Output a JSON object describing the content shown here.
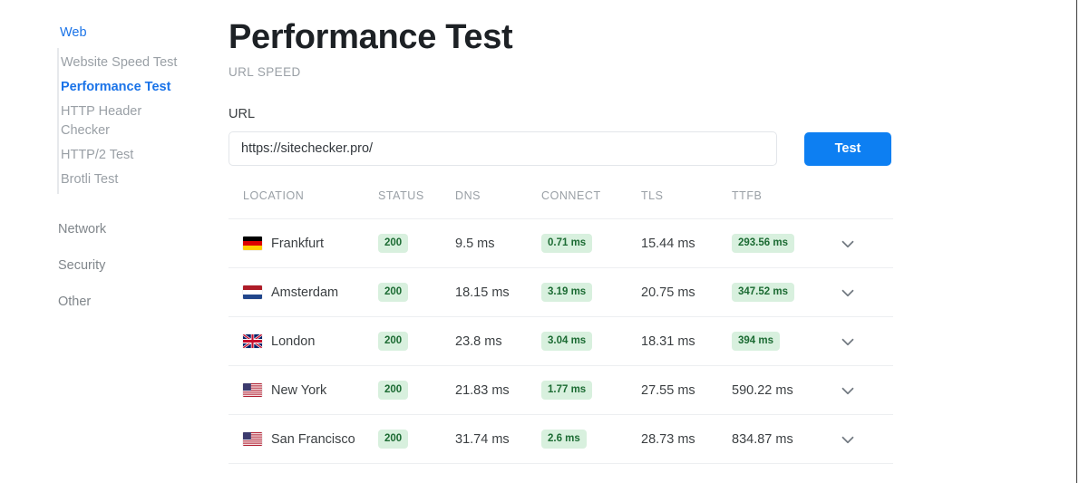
{
  "sidebar": {
    "groups": [
      {
        "label": "Web",
        "active": true,
        "items": [
          {
            "label": "Website Speed Test",
            "active": false
          },
          {
            "label": "Performance Test",
            "active": true
          },
          {
            "label": "HTTP Header Checker",
            "active": false
          },
          {
            "label": "HTTP/2 Test",
            "active": false
          },
          {
            "label": "Brotli Test",
            "active": false
          }
        ]
      }
    ],
    "top_items": [
      {
        "label": "Network"
      },
      {
        "label": "Security"
      },
      {
        "label": "Other"
      }
    ]
  },
  "header": {
    "title": "Performance Test",
    "subtitle": "URL SPEED"
  },
  "form": {
    "url_label": "URL",
    "url_value": "https://sitechecker.pro/",
    "url_placeholder": "https://sitechecker.pro/",
    "test_label": "Test"
  },
  "table": {
    "columns": [
      "LOCATION",
      "STATUS",
      "DNS",
      "CONNECT",
      "TLS",
      "TTFB"
    ],
    "expand_icon": "chevron-down-icon",
    "rows": [
      {
        "flag": "de",
        "location": "Frankfurt",
        "status": "200",
        "status_badge": true,
        "dns": "9.5 ms",
        "dns_badge": false,
        "connect": "0.71 ms",
        "connect_badge": true,
        "tls": "15.44 ms",
        "tls_badge": false,
        "ttfb": "293.56 ms",
        "ttfb_badge": true
      },
      {
        "flag": "nl",
        "location": "Amsterdam",
        "status": "200",
        "status_badge": true,
        "dns": "18.15 ms",
        "dns_badge": false,
        "connect": "3.19 ms",
        "connect_badge": true,
        "tls": "20.75 ms",
        "tls_badge": false,
        "ttfb": "347.52 ms",
        "ttfb_badge": true
      },
      {
        "flag": "gb",
        "location": "London",
        "status": "200",
        "status_badge": true,
        "dns": "23.8 ms",
        "dns_badge": false,
        "connect": "3.04 ms",
        "connect_badge": true,
        "tls": "18.31 ms",
        "tls_badge": false,
        "ttfb": "394 ms",
        "ttfb_badge": true
      },
      {
        "flag": "us",
        "location": "New York",
        "status": "200",
        "status_badge": true,
        "dns": "21.83 ms",
        "dns_badge": false,
        "connect": "1.77 ms",
        "connect_badge": true,
        "tls": "27.55 ms",
        "tls_badge": false,
        "ttfb": "590.22 ms",
        "ttfb_badge": false
      },
      {
        "flag": "us",
        "location": "San Francisco",
        "status": "200",
        "status_badge": true,
        "dns": "31.74 ms",
        "dns_badge": false,
        "connect": "2.6 ms",
        "connect_badge": true,
        "tls": "28.73 ms",
        "tls_badge": false,
        "ttfb": "834.87 ms",
        "ttfb_badge": false
      }
    ]
  },
  "colors": {
    "accent": "#0d7ff2",
    "link": "#1a73e8",
    "badge_bg": "#d8f0de",
    "badge_text": "#1c6b33",
    "muted": "#9aa0a6"
  }
}
